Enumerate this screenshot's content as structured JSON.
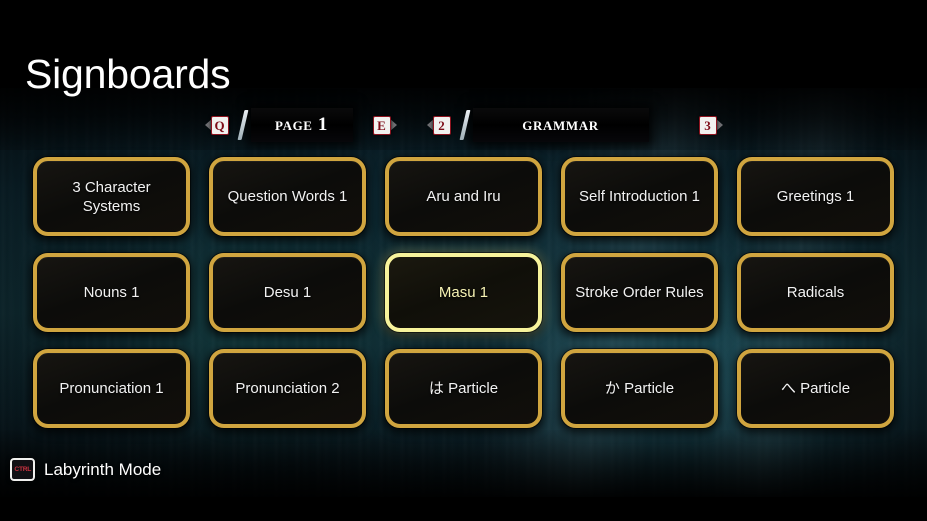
{
  "header": {
    "title": "Signboards"
  },
  "nav": {
    "prev_page_key": "Q",
    "prev_page_icon": "arrow-left-icon",
    "page_label": "Page 1",
    "next_page_key": "E",
    "next_page_icon": "arrow-right-icon",
    "prev_section_key": "2",
    "prev_section_icon": "arrow-left-icon",
    "section_label": "Grammar",
    "next_section_key": "3",
    "next_section_icon": "arrow-right-icon",
    "separator": "/"
  },
  "grid": {
    "rows": 3,
    "columns": 5,
    "selected_index": 7,
    "tiles": [
      {
        "label": "3 Character Systems",
        "selected": false
      },
      {
        "label": "Question Words 1",
        "selected": false
      },
      {
        "label": "Aru and Iru",
        "selected": false
      },
      {
        "label": "Self Introduction 1",
        "selected": false
      },
      {
        "label": "Greetings 1",
        "selected": false
      },
      {
        "label": "Nouns 1",
        "selected": false
      },
      {
        "label": "Desu 1",
        "selected": false
      },
      {
        "label": "Masu 1",
        "selected": true
      },
      {
        "label": "Stroke Order Rules",
        "selected": false
      },
      {
        "label": "Radicals",
        "selected": false
      },
      {
        "label": "Pronunciation 1",
        "selected": false
      },
      {
        "label": "Pronunciation 2",
        "selected": false
      },
      {
        "label": "は Particle",
        "selected": false
      },
      {
        "label": "か Particle",
        "selected": false
      },
      {
        "label": "へ Particle",
        "selected": false
      }
    ]
  },
  "footer": {
    "key": "CTRL",
    "label": "Labyrinth Mode"
  },
  "colors": {
    "tile_border": "#d0a53f",
    "tile_border_selected": "#f7f39b",
    "tile_text": "#f2f2f2",
    "tile_text_selected": "#f7f3b4",
    "key_accent": "#7e0d18",
    "background_teal": "#113139"
  }
}
